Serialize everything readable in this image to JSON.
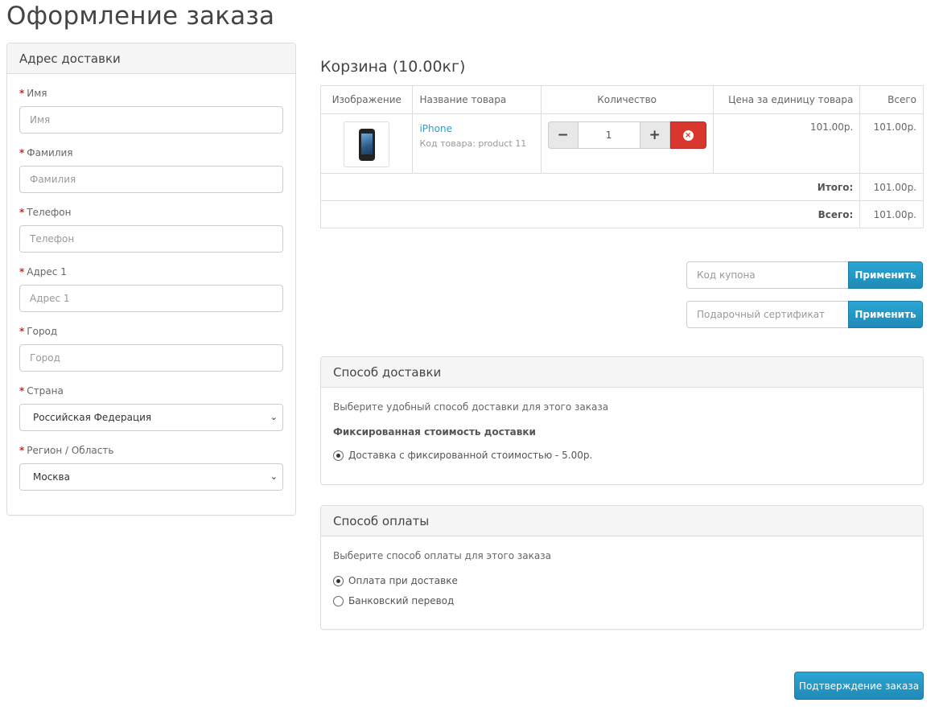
{
  "page": {
    "title": "Оформление заказа"
  },
  "address": {
    "heading": "Адрес доставки",
    "required_mark": "*",
    "fields": [
      {
        "label": "Имя",
        "placeholder": "Имя"
      },
      {
        "label": "Фамилия",
        "placeholder": "Фамилия"
      },
      {
        "label": "Телефон",
        "placeholder": "Телефон"
      },
      {
        "label": "Адрес 1",
        "placeholder": "Адрес 1"
      },
      {
        "label": "Город",
        "placeholder": "Город"
      }
    ],
    "country": {
      "label": "Страна",
      "value": "Российская Федерация"
    },
    "region": {
      "label": "Регион / Область",
      "value": "Москва"
    }
  },
  "cart": {
    "title": "Корзина (10.00кг)",
    "columns": [
      "Изображение",
      "Название товара",
      "Количество",
      "Цена за единицу товара",
      "Всего"
    ],
    "items": [
      {
        "name": "iPhone",
        "model": "Код товара: product 11",
        "quantity": "1",
        "price": "101.00р.",
        "total": "101.00р."
      }
    ],
    "totals": [
      {
        "label": "Итого:",
        "value": "101.00р."
      },
      {
        "label": "Всего:",
        "value": "101.00р."
      }
    ]
  },
  "coupon": {
    "placeholder": "Код купона",
    "button": "Применить"
  },
  "voucher": {
    "placeholder": "Подарочный сертификат",
    "button": "Применить"
  },
  "shipping": {
    "heading": "Способ доставки",
    "description": "Выберите удобный способ доставки для этого заказа",
    "group": "Фиксированная стоимость доставки",
    "options": [
      {
        "label": "Доставка с фиксированной стоимостью - 5.00р.",
        "checked": true
      }
    ]
  },
  "payment": {
    "heading": "Способ оплаты",
    "description": "Выберите способ оплаты для этого заказа",
    "options": [
      {
        "label": "Оплата при доставке",
        "checked": true
      },
      {
        "label": "Банковский перевод",
        "checked": false
      }
    ]
  },
  "confirm": {
    "button": "Подтверждение заказа"
  },
  "colors": {
    "primary": "#229ac8",
    "danger": "#d9362d",
    "link": "#23a1d1",
    "required": "#c62e1f"
  },
  "icons": {
    "minus": "minus-icon",
    "plus": "plus-icon",
    "remove": "times-circle-icon",
    "select": "chevron-down-icon"
  }
}
